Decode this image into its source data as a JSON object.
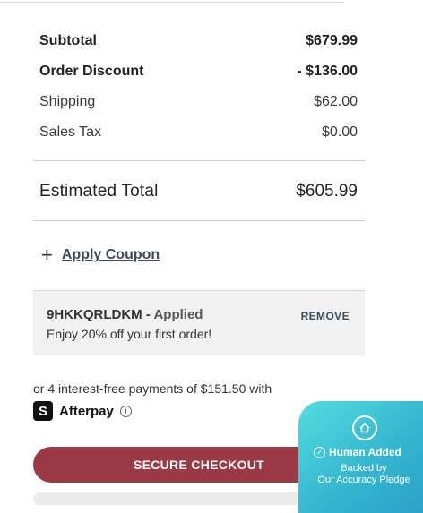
{
  "summary": {
    "subtotal_label": "Subtotal",
    "subtotal_value": "$679.99",
    "discount_label": "Order Discount",
    "discount_value": "- $136.00",
    "shipping_label": "Shipping",
    "shipping_value": "$62.00",
    "tax_label": "Sales Tax",
    "tax_value": "$0.00",
    "total_label": "Estimated Total",
    "total_value": "$605.99"
  },
  "coupon": {
    "link_label": "Apply Coupon",
    "code": "9HKKQRLDKM -",
    "status": "Applied",
    "description": "Enjoy 20% off your first order!",
    "remove_label": "REMOVE"
  },
  "afterpay": {
    "text": "or 4 interest-free payments of $151.50 with",
    "name": "Afterpay",
    "logo_glyph": "S",
    "info_glyph": "i"
  },
  "checkout": {
    "label": "SECURE CHECKOUT"
  },
  "pledge": {
    "added": "Human Added",
    "backed_line1": "Backed by",
    "backed_line2": "Our Accuracy Pledge"
  }
}
